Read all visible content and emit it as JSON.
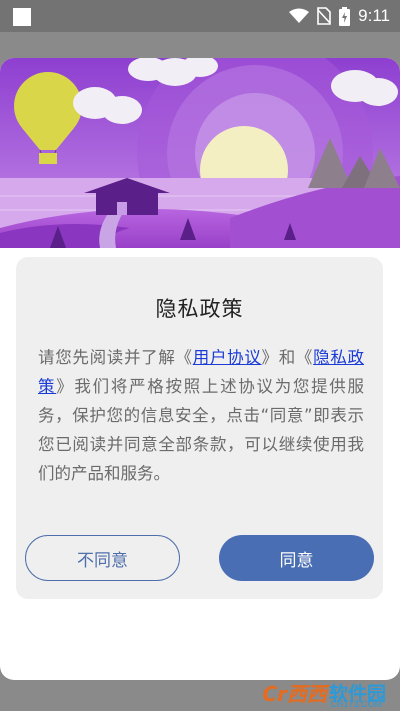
{
  "status_bar": {
    "time": "9:11"
  },
  "dialog": {
    "title": "隐私政策",
    "body_prefix": "请您先阅读并了解《",
    "link_user_agreement": "用户协议",
    "body_middle": "》和《",
    "link_privacy_policy": "隐私政策",
    "body_suffix": "》我们将严格按照上述协议为您提供服务，保护您的信息安全，点击“同意”即表示您已阅读并同意全部条款，可以继续使用我们的产品和服务。",
    "disagree_label": "不同意",
    "agree_label": "同意"
  },
  "watermark": {
    "logo_text": "Cr西西",
    "brand": "软件园",
    "url": "CR173.COM"
  },
  "colors": {
    "accent": "#4a6eb3",
    "link": "#1a3bd6",
    "banner_purple": "#9a4fd6"
  }
}
